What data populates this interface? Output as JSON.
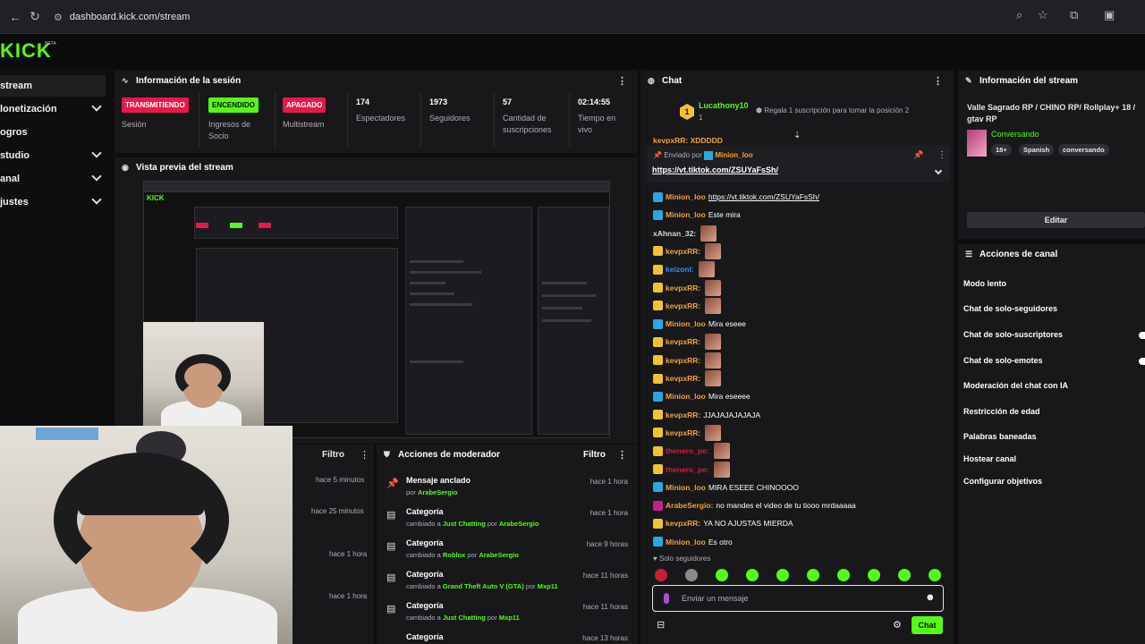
{
  "browser": {
    "url": "dashboard.kick.com/stream"
  },
  "logo": {
    "text": "KICK",
    "beta": "BETA"
  },
  "sidebar": {
    "items": [
      {
        "label": "stream",
        "active": true,
        "expandable": false
      },
      {
        "label": "lonetización",
        "expandable": true
      },
      {
        "label": "ogros",
        "expandable": false
      },
      {
        "label": "studio",
        "expandable": true
      },
      {
        "label": "anal",
        "expandable": true
      },
      {
        "label": "justes",
        "expandable": true
      }
    ]
  },
  "session": {
    "title": "Información de la sesión",
    "stats": [
      {
        "badge": "TRANSMITIENDO",
        "badge_color": "#e8194a",
        "label": "Sesión"
      },
      {
        "badge": "ENCENDIDO",
        "badge_color": "#53fc18",
        "label": "Ingresos de Socio"
      },
      {
        "badge": "APAGADO",
        "badge_color": "#e8194a",
        "label": "Multistream"
      },
      {
        "value": "174",
        "label": "Espectadores"
      },
      {
        "value": "1973",
        "label": "Seguidores"
      },
      {
        "value": "57",
        "label": "Cantidad de suscripciones"
      },
      {
        "value": "02:14:55",
        "label": "Tiempo en vivo"
      }
    ]
  },
  "preview": {
    "title": "Vista previa del stream"
  },
  "activity": {
    "filter": "Filtro",
    "times": [
      "hace 5 minutos",
      "hace 25 minutos",
      "hace 1 hora",
      "hace 1 hora"
    ]
  },
  "mod_actions": {
    "title": "Acciones de moderador",
    "filter": "Filtro",
    "items": [
      {
        "title": "Mensaje anclado",
        "prefix": "por",
        "user": "ArabeSergio",
        "time": "hace 1 hora",
        "icon": "pin-icon"
      },
      {
        "title": "Categoría",
        "prefix": "cambiado a",
        "target": "Just Chatting",
        "by": "por",
        "user": "ArabeSergio",
        "time": "hace 1 hora",
        "icon": "category-icon"
      },
      {
        "title": "Categoría",
        "prefix": "cambiado a",
        "target": "Roblox",
        "by": "por",
        "user": "ArabeSergio",
        "time": "hace 9 horas",
        "icon": "category-icon"
      },
      {
        "title": "Categoría",
        "prefix": "cambiado a",
        "target": "Grand Theft Auto V (GTA)",
        "by": "por",
        "user": "Mxp11",
        "time": "hace 11 horas",
        "icon": "category-icon"
      },
      {
        "title": "Categoría",
        "prefix": "cambiado a",
        "target": "Just Chatting",
        "by": "por",
        "user": "Mxp11",
        "time": "hace 11 horas",
        "icon": "category-icon"
      },
      {
        "title": "Categoría",
        "time": "hace 13 horas",
        "icon": "category-icon"
      }
    ]
  },
  "chat": {
    "title": "Chat",
    "gifter": {
      "name": "Lucathony10",
      "level": "1",
      "text": "Regala 1 suscripción para tomar la posición 2"
    },
    "pinned": {
      "prefix": "Enviado por",
      "user": "Minion_loo",
      "link": "https://vt.tiktok.com/ZSUYaFsSh/"
    },
    "top_cut": "kevpxRR: XDDDDD",
    "messages": [
      {
        "user": "Minion_loo",
        "color": "#f2a336",
        "badge": "mod",
        "text": "https://vt.tiktok.com/ZSUYaFsSh/",
        "link": true
      },
      {
        "user": "Minion_loo",
        "color": "#f2a336",
        "badge": "mod",
        "text": "Este mira"
      },
      {
        "user": "xAhnan_32:",
        "color": "#d8d8d8",
        "badge": "",
        "emote": true
      },
      {
        "user": "kevpxRR:",
        "color": "#f2a336",
        "badge": "sub",
        "emote": true
      },
      {
        "user": "keizonl:",
        "color": "#3b8cff",
        "badge": "sub",
        "emote": true
      },
      {
        "user": "kevpxRR:",
        "color": "#f2a336",
        "badge": "sub",
        "emote": true
      },
      {
        "user": "kevpxRR:",
        "color": "#f2a336",
        "badge": "sub",
        "emote": true
      },
      {
        "user": "Minion_loo",
        "color": "#f2a336",
        "badge": "mod",
        "text": "Mira eseee"
      },
      {
        "user": "kevpxRR:",
        "color": "#f2a336",
        "badge": "sub",
        "emote": true
      },
      {
        "user": "kevpxRR:",
        "color": "#f2a336",
        "badge": "sub",
        "emote": true
      },
      {
        "user": "kevpxRR:",
        "color": "#f2a336",
        "badge": "sub",
        "emote": true
      },
      {
        "user": "Minion_loo",
        "color": "#f2a336",
        "badge": "mod",
        "text": "Mira eseeee"
      },
      {
        "user": "kevpxRR:",
        "color": "#f2a336",
        "badge": "sub",
        "text": "JJAJAJAJAJAJA"
      },
      {
        "user": "kevpxRR:",
        "color": "#f2a336",
        "badge": "sub",
        "emote": true
      },
      {
        "user": "thenero_pe:",
        "color": "#d81c3c",
        "badge": "sub",
        "emote": true
      },
      {
        "user": "thenero_pe:",
        "color": "#d81c3c",
        "badge": "sub",
        "emote": true
      },
      {
        "user": "Minion_loo",
        "color": "#f2a336",
        "badge": "mod",
        "text": "MIRA ESEEE CHINOOOO"
      },
      {
        "user": "ArabeSergio:",
        "color": "#f2a336",
        "badge": "vip",
        "text": "no mandes el video de tu tiooo mrdaaaaa"
      },
      {
        "user": "kevpxRR:",
        "color": "#f2a336",
        "badge": "sub",
        "text": "YA NO AJUSTAS MIERDA"
      },
      {
        "user": "Minion_loo",
        "color": "#f2a336",
        "badge": "mod",
        "text": "Es otro"
      }
    ],
    "mode": "Solo seguidores",
    "input_placeholder": "Enviar un mensaje",
    "send": "Chat"
  },
  "stream_info": {
    "title": "Información del stream",
    "stream_title": "Valle Sagrado RP / CHINO RP/ Rollplay+ 18 / gtav RP",
    "category": "Conversando",
    "tags": [
      "18+",
      "Spanish",
      "conversando"
    ],
    "edit": "Editar"
  },
  "channel_actions": {
    "title": "Acciones de canal",
    "items": [
      "Modo lento",
      "Chat de solo-seguidores",
      "Chat de solo-suscriptores",
      "Chat de solo-emotes",
      "Moderación del chat con IA",
      "Restricción de edad",
      "Palabras baneadas",
      "Hostear canal",
      "Configurar objetivos"
    ]
  },
  "colors": {
    "accent": "#53fc18",
    "live": "#e8194a",
    "panel": "#18181b",
    "bg": "#0e0e10"
  }
}
